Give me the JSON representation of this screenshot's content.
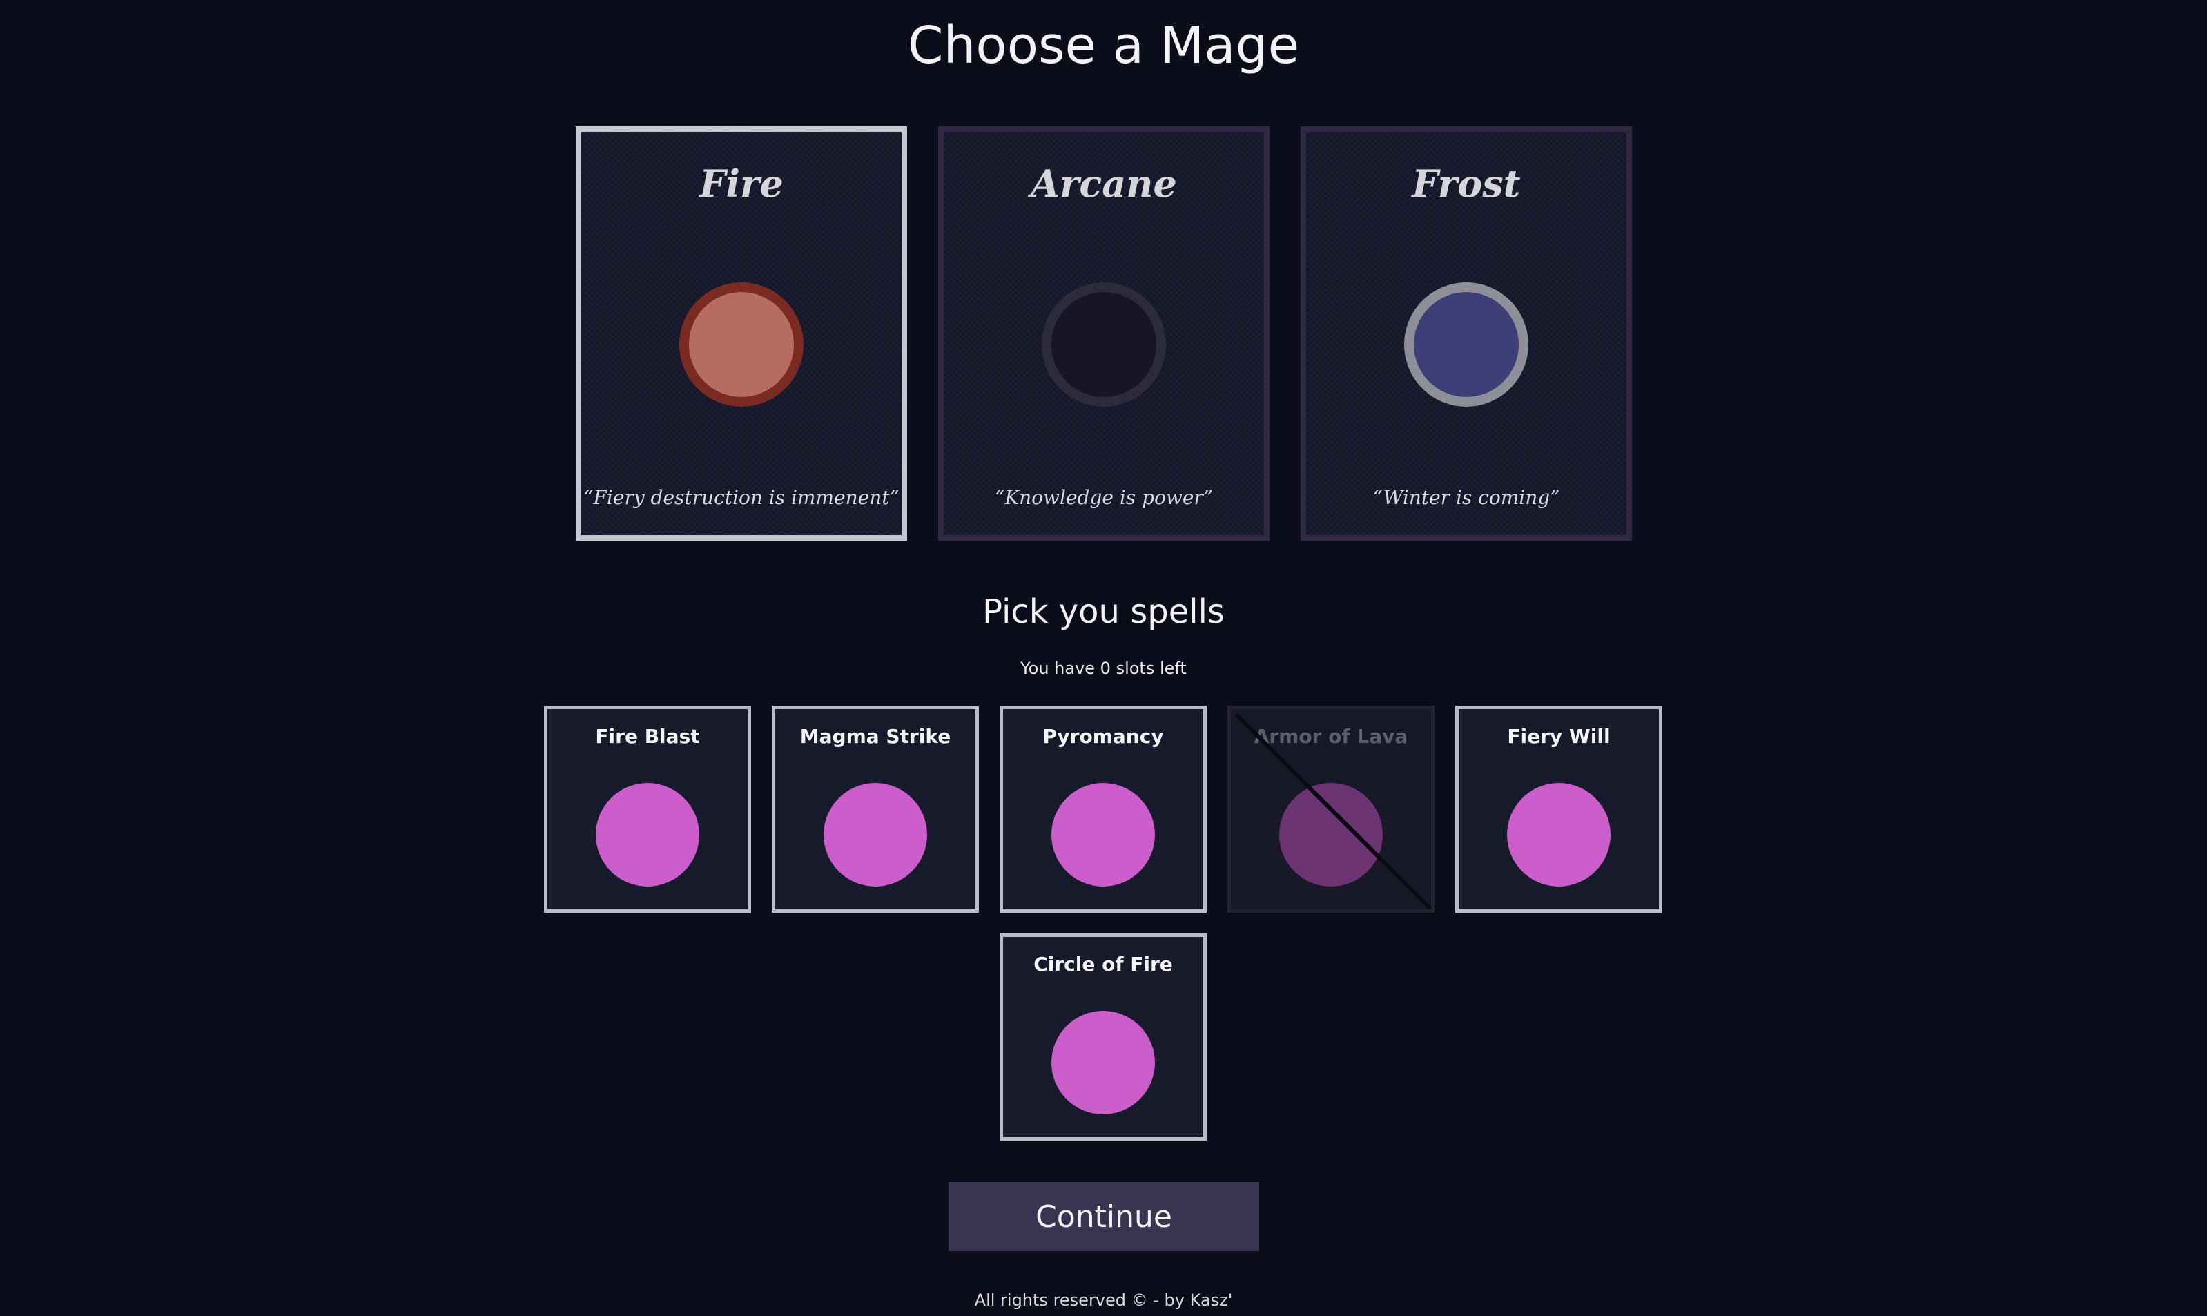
{
  "title": "Choose a Mage",
  "mages": [
    {
      "name": "Fire",
      "quote": "“Fiery destruction is immenent”",
      "selected": true,
      "orb_color": "#b46d5e",
      "orb_ring": "#7a2a22"
    },
    {
      "name": "Arcane",
      "quote": "“Knowledge is power”",
      "selected": false,
      "orb_color": "#1a1526",
      "orb_ring": "#2c2a3c"
    },
    {
      "name": "Frost",
      "quote": "“Winter is coming”",
      "selected": false,
      "orb_color": "#3f3f77",
      "orb_ring": "#8e8f98"
    }
  ],
  "spells_section": {
    "title": "Pick you spells",
    "slots_text": "You have 0 slots left"
  },
  "spells": [
    {
      "name": "Fire Blast",
      "disabled": false,
      "color": "#cc5ecb"
    },
    {
      "name": "Magma Strike",
      "disabled": false,
      "color": "#cc5ecb"
    },
    {
      "name": "Pyromancy",
      "disabled": false,
      "color": "#cc5ecb"
    },
    {
      "name": "Armor of Lava",
      "disabled": true,
      "color": "#6c3472"
    },
    {
      "name": "Fiery Will",
      "disabled": false,
      "color": "#cc5ecb"
    },
    {
      "name": "Circle of Fire",
      "disabled": false,
      "color": "#cc5ecb"
    }
  ],
  "continue_label": "Continue",
  "footer": "All rights reserved © - by Kasz'"
}
